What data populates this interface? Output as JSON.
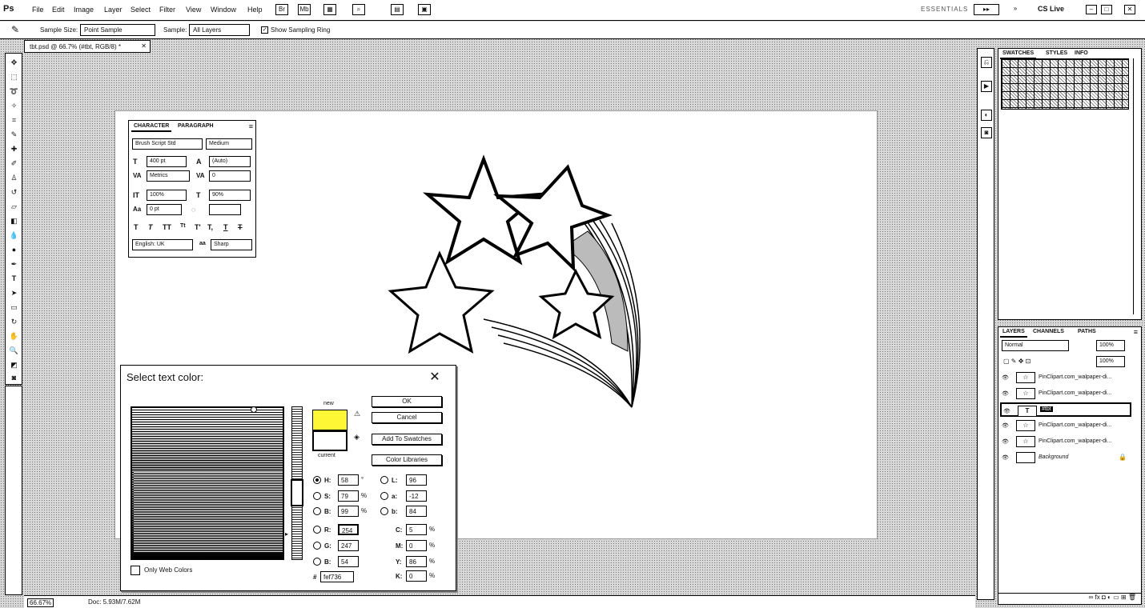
{
  "menubar": {
    "logo": "Ps",
    "items": [
      "File",
      "Edit",
      "Image",
      "Layer",
      "Select",
      "Filter",
      "View",
      "Window",
      "Help"
    ],
    "workspace": "ESSENTIALS",
    "cs_live": "CS Live"
  },
  "options": {
    "sample_size_label": "Sample Size:",
    "sample_size_value": "Point Sample",
    "sample_label": "Sample:",
    "sample_value": "All Layers",
    "show_ring_label": "Show Sampling Ring"
  },
  "document": {
    "tab_title": "tbt.psd @ 66.7% (#tbt, RGB/8) *",
    "zoom": "66.67%",
    "doc_info": "Doc: 5.93M/7.62M"
  },
  "character_panel": {
    "tab_character": "CHARACTER",
    "tab_paragraph": "PARAGRAPH",
    "font_family": "Brush Script Std",
    "font_style": "Medium",
    "font_size": "400 pt",
    "leading": "(Auto)",
    "kerning": "Metrics",
    "tracking": "0",
    "vertical_scale": "100%",
    "horizontal_scale": "90%",
    "baseline": "0 pt",
    "language": "English: UK",
    "antialias": "Sharp"
  },
  "color_dialog": {
    "title": "Select text color:",
    "new_label": "new",
    "current_label": "current",
    "ok": "OK",
    "cancel": "Cancel",
    "add_to_swatches": "Add To Swatches",
    "color_libraries": "Color Libraries",
    "H": "58",
    "S": "79",
    "B": "99",
    "R": "254",
    "G": "247",
    "Bv": "54",
    "L": "96",
    "a": "-12",
    "b": "84",
    "C": "5",
    "M": "0",
    "Y": "86",
    "K": "0",
    "hex": "fef736",
    "only_web_label": "Only Web Colors",
    "new_color": "#fef736"
  },
  "swatches_panel": {
    "tabs": [
      "SWATCHES",
      "STYLES",
      "INFO"
    ]
  },
  "layers_panel": {
    "tabs": [
      "LAYERS",
      "CHANNELS",
      "PATHS"
    ],
    "blend_mode": "Normal",
    "opacity": "100%",
    "fill": "100%",
    "layers": [
      {
        "name": "PinClipart.com_walpaper-di...",
        "type": "image"
      },
      {
        "name": "PinClipart.com_walpaper-di...",
        "type": "image"
      },
      {
        "name": "#tbt",
        "type": "text",
        "selected": true
      },
      {
        "name": "PinClipart.com_walpaper-di...",
        "type": "image"
      },
      {
        "name": "PinClipart.com_walpaper-di...",
        "type": "image"
      },
      {
        "name": "Background",
        "type": "background"
      }
    ]
  }
}
